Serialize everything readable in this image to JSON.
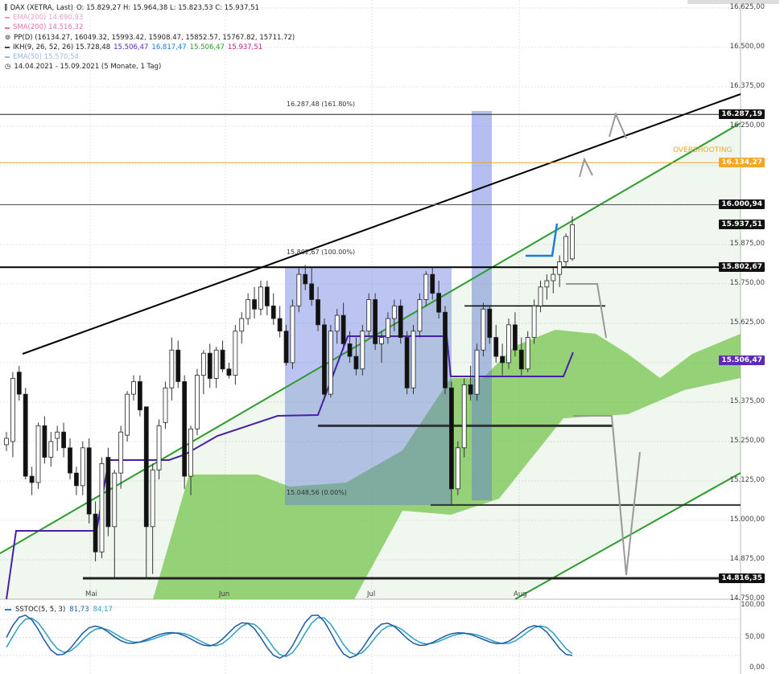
{
  "legend": {
    "instrument": "DAX (XETRA, Last)",
    "ohlc": "O: 15.829,27   H: 15.964,38   L: 15.823,53   C: 15.937,51",
    "ema200": "EMA(200)  14.690,93",
    "sma200": "SMA(200)  14.516,32",
    "pp": "PP(D)  (16134.27, 16049.32, 15993.42, 15908.47, 15852.57, 15767.82, 15711.72)",
    "ikh_prefix": "IKH(9, 26, 52, 26)  15.728,48",
    "ikh_v1": "15.506,47",
    "ikh_v2": "16.817,47",
    "ikh_v3": "15.506,47",
    "ikh_v4": "15.937,51",
    "ema50": "EMA(50)  15.570,54",
    "range": "14.04.2021 - 15.09.2021   (5 Monate, 1 Tag)"
  },
  "oscillator": {
    "label": "SSTOC(5, 5, 3)",
    "v1": "81,73",
    "v2": "84,17",
    "ticks": [
      "100,00",
      "50,00",
      "0,00"
    ]
  },
  "annotations": {
    "fib_top": "16.287,48 (161.80%)",
    "fib_mid": "15.802,67 (100.00%)",
    "fib_bottom": "15.048,56 (0.00%)",
    "overshooting": "OVERSHOOTING"
  },
  "price_labels": [
    {
      "text": "16.287,19",
      "value": 16287.19,
      "color": "#111111"
    },
    {
      "text": "16.134,27",
      "value": 16134.27,
      "color": "#f5a623"
    },
    {
      "text": "16.000,94",
      "value": 16000.94,
      "color": "#111111"
    },
    {
      "text": "15.937,51",
      "value": 15937.51,
      "color": "#111111"
    },
    {
      "text": "15.802,67",
      "value": 15802.67,
      "color": "#111111"
    },
    {
      "text": "15.506,47",
      "value": 15506.47,
      "color": "#5b2bb5"
    },
    {
      "text": "14.816,35",
      "value": 14816.35,
      "color": "#111111"
    }
  ],
  "colors": {
    "cloud": "#7ec850",
    "kijun": "#4a1fa8",
    "trend_black": "#000000",
    "trend_green": "#2e9b2e",
    "fib_box": "#6a7fe0",
    "overshoot": "#f5a623",
    "arrow_gray": "#999999",
    "arrow_blue": "#1e7be0"
  },
  "chart_data": {
    "type": "candlestick",
    "title": "DAX (XETRA, Last)",
    "x_labels": [
      "Mai",
      "Jun",
      "Jul",
      "Aug"
    ],
    "y_ticks": [
      16625,
      16500,
      16375,
      16250,
      16125,
      16000,
      15875,
      15750,
      15625,
      15500,
      15375,
      15250,
      15125,
      15000,
      14875,
      14750
    ],
    "y_tick_labels": [
      "16.625,00",
      "16.500,00",
      "16.375,00",
      "16.250,00",
      "16.125,00",
      "16.000,00",
      "15.875,00",
      "15.750,00",
      "15.625,00",
      "15.500,00",
      "15.375,00",
      "15.250,00",
      "15.125,00",
      "15.000,00",
      "14.875,00",
      "14.750,00"
    ],
    "ylim": [
      14750,
      16650
    ],
    "horizontal_levels": [
      16287.19,
      16134.27,
      16000.94,
      15802.67,
      15680,
      15300,
      15048.56,
      14816.35
    ],
    "candles": [
      [
        15240,
        15280,
        15220,
        15260
      ],
      [
        15250,
        15470,
        15200,
        15450
      ],
      [
        15470,
        15490,
        15380,
        15400
      ],
      [
        15400,
        15420,
        15130,
        15140
      ],
      [
        15140,
        15170,
        15080,
        15120
      ],
      [
        15120,
        15310,
        15100,
        15300
      ],
      [
        15300,
        15330,
        15180,
        15200
      ],
      [
        15200,
        15280,
        15170,
        15250
      ],
      [
        15260,
        15300,
        15220,
        15280
      ],
      [
        15280,
        15310,
        15200,
        15230
      ],
      [
        15230,
        15260,
        15130,
        15150
      ],
      [
        15150,
        15170,
        15080,
        15110
      ],
      [
        15110,
        15250,
        15080,
        15230
      ],
      [
        15230,
        15260,
        14990,
        15020
      ],
      [
        15020,
        15060,
        14870,
        14900
      ],
      [
        14900,
        15200,
        14880,
        15180
      ],
      [
        15200,
        15230,
        14950,
        14980
      ],
      [
        14980,
        15160,
        14820,
        15150
      ],
      [
        15150,
        15300,
        15100,
        15280
      ],
      [
        15270,
        15410,
        15250,
        15400
      ],
      [
        15400,
        15460,
        15380,
        15440
      ],
      [
        15440,
        15460,
        15330,
        15350
      ],
      [
        15360,
        14980,
        14820,
        14980
      ],
      [
        14980,
        15180,
        14830,
        15160
      ],
      [
        15160,
        15320,
        15130,
        15300
      ],
      [
        15310,
        15440,
        15290,
        15420
      ],
      [
        15420,
        15580,
        15380,
        15540
      ],
      [
        15540,
        15570,
        15420,
        15440
      ],
      [
        15440,
        15460,
        15100,
        15140
      ],
      [
        15140,
        15300,
        15080,
        15290
      ],
      [
        15290,
        15480,
        15270,
        15460
      ],
      [
        15460,
        15540,
        15400,
        15530
      ],
      [
        15530,
        15560,
        15420,
        15450
      ],
      [
        15450,
        15550,
        15420,
        15540
      ],
      [
        15540,
        15570,
        15470,
        15480
      ],
      [
        15480,
        15500,
        15450,
        15460
      ],
      [
        15460,
        15620,
        15430,
        15600
      ],
      [
        15600,
        15660,
        15560,
        15640
      ],
      [
        15640,
        15720,
        15620,
        15700
      ],
      [
        15700,
        15740,
        15640,
        15670
      ],
      [
        15670,
        15760,
        15650,
        15740
      ],
      [
        15740,
        15760,
        15650,
        15680
      ],
      [
        15680,
        15720,
        15620,
        15640
      ],
      [
        15640,
        15680,
        15580,
        15600
      ],
      [
        15600,
        15620,
        15490,
        15500
      ],
      [
        15500,
        15700,
        15480,
        15680
      ],
      [
        15680,
        15800,
        15660,
        15780
      ],
      [
        15780,
        15810,
        15730,
        15750
      ],
      [
        15750,
        15800,
        15680,
        15700
      ],
      [
        15700,
        15740,
        15600,
        15620
      ],
      [
        15620,
        15640,
        15380,
        15400
      ],
      [
        15400,
        15620,
        15390,
        15600
      ],
      [
        15600,
        15670,
        15560,
        15650
      ],
      [
        15650,
        15690,
        15540,
        15560
      ],
      [
        15560,
        15600,
        15500,
        15520
      ],
      [
        15520,
        15580,
        15460,
        15480
      ],
      [
        15480,
        15620,
        15460,
        15600
      ],
      [
        15600,
        15720,
        15580,
        15700
      ],
      [
        15700,
        15720,
        15540,
        15560
      ],
      [
        15560,
        15600,
        15500,
        15580
      ],
      [
        15580,
        15660,
        15560,
        15640
      ],
      [
        15640,
        15700,
        15600,
        15680
      ],
      [
        15680,
        15700,
        15560,
        15580
      ],
      [
        15580,
        15600,
        15400,
        15420
      ],
      [
        15420,
        15620,
        15400,
        15600
      ],
      [
        15600,
        15720,
        15580,
        15700
      ],
      [
        15700,
        15790,
        15680,
        15780
      ],
      [
        15780,
        15800,
        15700,
        15720
      ],
      [
        15720,
        15760,
        15640,
        15660
      ],
      [
        15660,
        15680,
        15400,
        15420
      ],
      [
        15420,
        15440,
        15050,
        15100
      ],
      [
        15100,
        15250,
        15080,
        15230
      ],
      [
        15230,
        15450,
        15200,
        15430
      ],
      [
        15430,
        15490,
        15380,
        15400
      ],
      [
        15400,
        15560,
        15380,
        15540
      ],
      [
        15540,
        15690,
        15520,
        15670
      ],
      [
        15670,
        15680,
        15560,
        15580
      ],
      [
        15580,
        15620,
        15500,
        15520
      ],
      [
        15520,
        15560,
        15460,
        15500
      ],
      [
        15500,
        15640,
        15480,
        15620
      ],
      [
        15620,
        15660,
        15520,
        15540
      ],
      [
        15540,
        15580,
        15460,
        15480
      ],
      [
        15480,
        15600,
        15470,
        15580
      ],
      [
        15580,
        15700,
        15560,
        15680
      ],
      [
        15680,
        15760,
        15660,
        15740
      ],
      [
        15740,
        15780,
        15700,
        15760
      ],
      [
        15760,
        15800,
        15720,
        15780
      ],
      [
        15780,
        15840,
        15740,
        15820
      ],
      [
        15820,
        15910,
        15800,
        15900
      ],
      [
        15829.27,
        15964.38,
        15823.53,
        15937.51
      ]
    ],
    "oscillator_range": [
      0,
      100
    ]
  }
}
